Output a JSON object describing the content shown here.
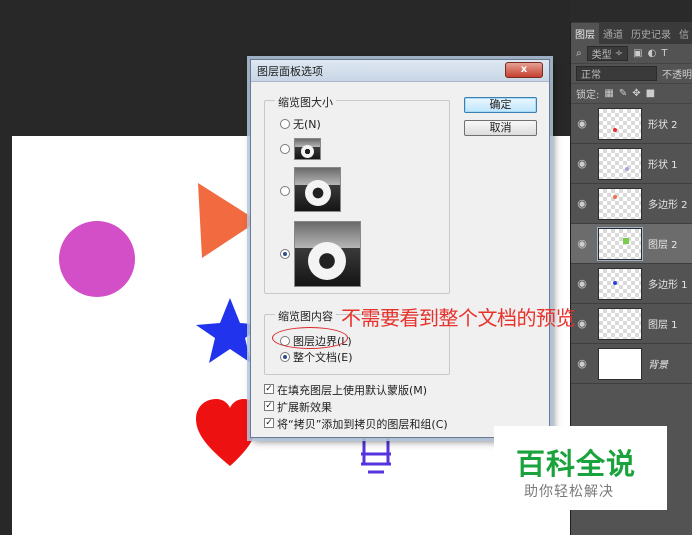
{
  "layers_panel": {
    "tabs": [
      "图层",
      "通道",
      "历史记录",
      "信"
    ],
    "filter_label": "类型",
    "blend_mode": "正常",
    "opacity_label": "不透明",
    "lock_label": "锁定:",
    "layers": [
      {
        "name": "形状 2",
        "dot_color": "#e83030"
      },
      {
        "name": "形状 1",
        "dot_color": "#b0a0e0"
      },
      {
        "name": "多边形 2",
        "dot_color": "#f07050"
      },
      {
        "name": "图层 2",
        "dot_color": "#7acc4a"
      },
      {
        "name": "多边形 1",
        "dot_color": "#3040e0"
      },
      {
        "name": "图层 1",
        "dot_color": ""
      },
      {
        "name": "背景",
        "dot_color": ""
      }
    ]
  },
  "dialog": {
    "title": "图层面板选项",
    "close_label": "x",
    "thumb_size_group": "缩览图大小",
    "option_none": "无(N)",
    "thumb_content_group": "缩览图内容",
    "option_layer_bounds": "图层边界(L)",
    "option_entire_doc": "整个文档(E)",
    "ok_label": "确定",
    "cancel_label": "取消",
    "chk_default_masks": "在填充图层上使用默认蒙版(M)",
    "chk_expand_effects": "扩展新效果",
    "chk_copy_groups": "将“拷贝”添加到拷贝的图层和组(C)"
  },
  "annotation": {
    "text": "不需要看到整个文档的预览"
  },
  "watermark": {
    "title": "百科全说",
    "subtitle": "助你轻松解决"
  },
  "colors": {
    "circle": "#d24fc8",
    "triangle": "#f26a40",
    "star": "#2233ee",
    "heart": "#ee1111",
    "bulb": "#5533dd",
    "annotation": "#e8332d",
    "watermark_green": "#1aa33c"
  }
}
